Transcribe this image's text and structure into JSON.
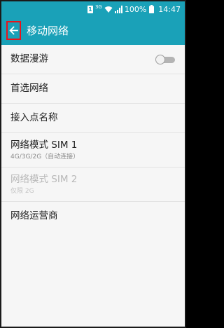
{
  "status_bar": {
    "sim_label": "1",
    "network_type": "3G",
    "battery_percent": "100%",
    "time": "14:47"
  },
  "app_bar": {
    "title": "移动网络",
    "back_icon": "arrow-left-icon"
  },
  "settings": [
    {
      "title": "数据漫游",
      "toggle": false
    },
    {
      "title": "首选网络"
    },
    {
      "title": "接入点名称"
    },
    {
      "title": "网络模式 SIM 1",
      "subtitle": "4G/3G/2G（自动连接）"
    },
    {
      "title": "网络模式 SIM 2",
      "subtitle": "仅限 2G",
      "disabled": true
    },
    {
      "title": "网络运营商"
    }
  ],
  "colors": {
    "accent": "#1aa1b8",
    "highlight_box": "#e8141b",
    "background": "#f6f6f6"
  }
}
